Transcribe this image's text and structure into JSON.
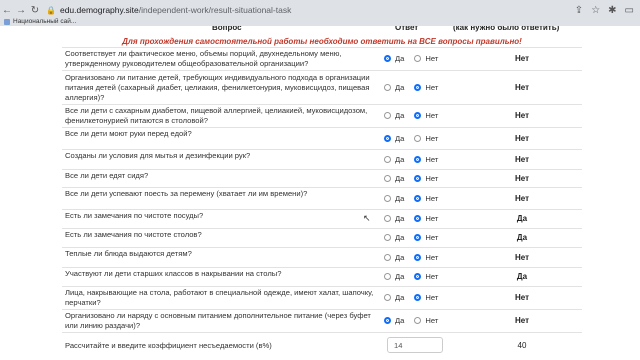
{
  "browser": {
    "url_host": "edu.demography.site",
    "url_path": "/independent-work/result-situational-task",
    "bookmark_label": "Национальный сай..."
  },
  "table": {
    "col_question": "Вопрос",
    "col_answer": "Ответ",
    "col_correct": "(как нужно было ответить)"
  },
  "notice": "Для прохождения самостоятельной работы необходимо ответить на ВСЕ вопросы правильно!",
  "option_yes": "Да",
  "option_no": "Нет",
  "questions": [
    {
      "text": "Соответствует ли фактическое меню, объемы порций, двухнедельному меню, утвержденному руководителем общеобразовательной организации?",
      "selected": "yes",
      "correct": "Нет"
    },
    {
      "text": "Организовано ли питание детей, требующих индивидуального подхода в организации питания детей (сахарный диабет, целиакия, фенилкетонурия, муковисцидоз, пищевая аллергия)?",
      "selected": "no",
      "correct": "Нет"
    },
    {
      "text": "Все ли дети с сахарным диабетом, пищевой аллергией, целиакией, муковисцидозом, фенилкетонурией питаются в столовой?",
      "selected": "no",
      "correct": "Нет"
    },
    {
      "text": "Все ли дети моют руки перед едой?",
      "selected": "yes",
      "correct": "Нет"
    },
    {
      "text": "Созданы ли условия для мытья и дезинфекции рук?",
      "selected": "no",
      "correct": "Нет"
    },
    {
      "text": "Все ли дети едят сидя?",
      "selected": "no",
      "correct": "Нет"
    },
    {
      "text": "Все ли дети успевают поесть за перемену (хватает ли им времени)?",
      "selected": "no",
      "correct": "Нет"
    },
    {
      "text": "Есть ли замечания по чистоте посуды?",
      "selected": "no",
      "correct": "Да"
    },
    {
      "text": "Есть ли замечания по чистоте столов?",
      "selected": "no",
      "correct": "Да"
    },
    {
      "text": "Теплые ли блюда выдаются детям?",
      "selected": "no",
      "correct": "Нет"
    },
    {
      "text": "Участвуют ли дети старших классов в накрывании на столы?",
      "selected": "no",
      "correct": "Да"
    },
    {
      "text": "Лица, накрывающие на стола, работают в специальной одежде, имеют халат, шапочку, перчатки?",
      "selected": "no",
      "correct": "Нет"
    },
    {
      "text": "Организовано ли наряду с основным питанием дополнительное питание (через буфет или линию раздачи)?",
      "selected": "yes",
      "correct": "Нет"
    }
  ],
  "calc": {
    "label": "Рассчитайте и введите коэффициент несъедаемости (в%)",
    "input_value": "14",
    "correct": "40"
  }
}
